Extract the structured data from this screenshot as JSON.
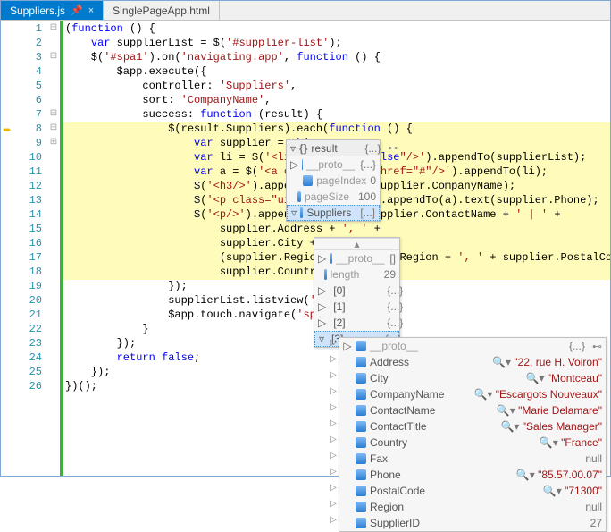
{
  "tabs": [
    {
      "label": "Suppliers.js",
      "active": true
    },
    {
      "label": "SinglePageApp.html",
      "active": false
    }
  ],
  "code": {
    "lines": [
      "(function () {",
      "    var supplierList = $('#supplier-list');",
      "    $('#spa1').on('navigating.app', function () {",
      "        $app.execute({",
      "            controller: 'Suppliers',",
      "            sort: 'CompanyName',",
      "            success: function (result) {",
      "                $(result.Suppliers).each(function () {",
      "                    var supplier = this;",
      "                    var li = $('<li data-icon=\"false\"/>').appendTo(supplierList);",
      "                    var a = $('<a class=\"ui-btn\" href=\"#\"/>').appendTo(li);",
      "                    $('<h3/>').appendTo(a).text(supplier.CompanyName);",
      "                    $('<p class=\"ui-li-aside\"/>').appendTo(a).text(supplier.Phone);",
      "                    $('<p/>').appendTo(a).text(supplier.ContactName + ' | ' +",
      "                        supplier.Address + ', ' +",
      "                        supplier.City + ', ' +",
      "                        (supplier.Region ? supplier.Region + ', ' + supplier.PostalCode + ', ' +",
      "                        supplier.Country));",
      "                });",
      "                supplierList.listview('refresh');",
      "                $app.touch.navigate('spa1');",
      "            }",
      "        });",
      "        return false;",
      "    });",
      "})();"
    ],
    "breakpointLine": 8,
    "highlight": {
      "start": 8,
      "end": 18
    },
    "foldMarks": {
      "1": "-",
      "3": "-",
      "7": "-",
      "8": "-",
      "9": "+"
    }
  },
  "tooltip1": {
    "header": {
      "name": "result",
      "value": "{...}"
    },
    "rows": [
      {
        "exp": "▷",
        "name": "__proto__",
        "value": "{...}",
        "dim": true
      },
      {
        "exp": "",
        "name": "pageIndex",
        "value": "0",
        "dim": true
      },
      {
        "exp": "",
        "name": "pageSize",
        "value": "100",
        "dim": true
      },
      {
        "exp": "▿",
        "name": "Suppliers",
        "value": "[...]",
        "dim": false,
        "selected": true
      }
    ]
  },
  "tooltip2": {
    "rows": [
      {
        "exp": "▷",
        "name": "__proto__",
        "value": "[]",
        "dim": true
      },
      {
        "exp": "",
        "name": "length",
        "value": "29",
        "dim": true
      },
      {
        "exp": "▷",
        "name": "[0]",
        "value": "{...}",
        "dim": false
      },
      {
        "exp": "▷",
        "name": "[1]",
        "value": "{...}",
        "dim": false
      },
      {
        "exp": "▷",
        "name": "[2]",
        "value": "{...}",
        "dim": false
      },
      {
        "exp": "▿",
        "name": "[3]",
        "value": "{...}",
        "dim": false,
        "selected": true
      }
    ]
  },
  "tooltip3": {
    "rows": [
      {
        "exp": "▷",
        "name": "__proto__",
        "value": "{...}",
        "type": "obj",
        "dim": true
      },
      {
        "exp": "",
        "name": "Address",
        "value": "\"22, rue H. Voiron\"",
        "type": "str"
      },
      {
        "exp": "",
        "name": "City",
        "value": "\"Montceau\"",
        "type": "str"
      },
      {
        "exp": "",
        "name": "CompanyName",
        "value": "\"Escargots Nouveaux\"",
        "type": "str"
      },
      {
        "exp": "",
        "name": "ContactName",
        "value": "\"Marie Delamare\"",
        "type": "str"
      },
      {
        "exp": "",
        "name": "ContactTitle",
        "value": "\"Sales Manager\"",
        "type": "str"
      },
      {
        "exp": "",
        "name": "Country",
        "value": "\"France\"",
        "type": "str"
      },
      {
        "exp": "",
        "name": "Fax",
        "value": "null",
        "type": "null"
      },
      {
        "exp": "",
        "name": "Phone",
        "value": "\"85.57.00.07\"",
        "type": "str"
      },
      {
        "exp": "",
        "name": "PostalCode",
        "value": "\"71300\"",
        "type": "str"
      },
      {
        "exp": "",
        "name": "Region",
        "value": "null",
        "type": "null"
      },
      {
        "exp": "",
        "name": "SupplierID",
        "value": "27",
        "type": "num"
      }
    ]
  }
}
